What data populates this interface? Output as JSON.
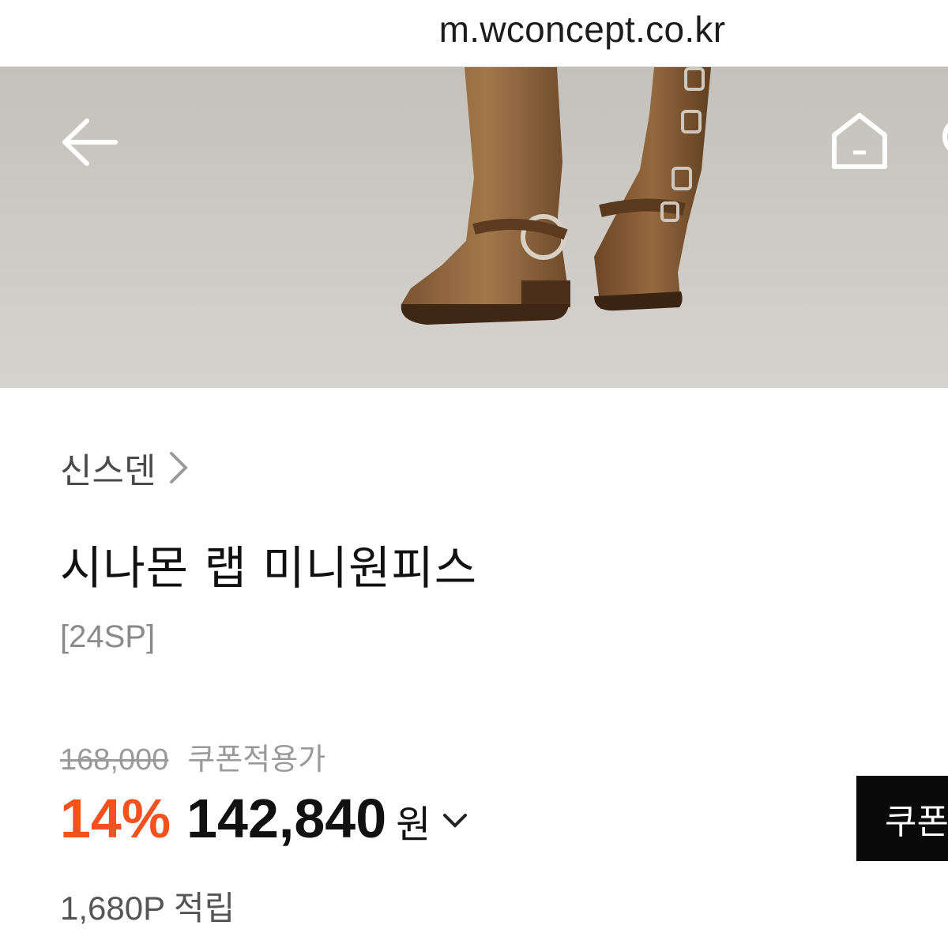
{
  "browser": {
    "url": "m.wconcept.co.kr"
  },
  "hero": {
    "image_alt": "brown leather boots product photo"
  },
  "nav": {
    "back_icon": "back-arrow-icon",
    "home_icon": "home-icon"
  },
  "product": {
    "brand": "신스덴",
    "title": "시나몬 랩 미니원피스",
    "season": "[24SP]",
    "original_price": "168,000",
    "coupon_price_label": "쿠폰적용가",
    "discount": "14%",
    "price": "142,840",
    "currency": "원",
    "coupon_button": "쿠폰",
    "points": "1,680P 적립"
  },
  "colors": {
    "accent": "#f4511e",
    "button_bg": "#0a0a0a"
  }
}
